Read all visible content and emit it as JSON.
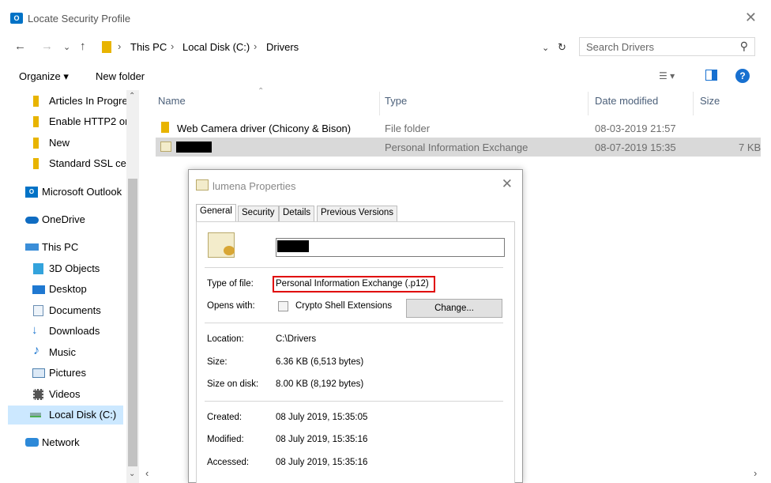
{
  "window": {
    "title": "Locate Security Profile",
    "title_icon": "O"
  },
  "address": {
    "crumbs": [
      "This PC",
      "Local Disk (C:)",
      "Drivers"
    ],
    "search_placeholder": "Search Drivers"
  },
  "toolbar": {
    "organize": "Organize ▾",
    "new_folder": "New folder"
  },
  "sidebar": {
    "items": [
      {
        "label": "Articles In Progre",
        "icon": "folder-icon"
      },
      {
        "label": "Enable HTTP2 or",
        "icon": "folder-icon"
      },
      {
        "label": "New",
        "icon": "folder-icon"
      },
      {
        "label": "Standard SSL cer",
        "icon": "folder-icon"
      },
      {
        "label": "Microsoft Outlook",
        "icon": "outlook-icon"
      },
      {
        "label": "OneDrive",
        "icon": "cloud-icon"
      },
      {
        "label": "This PC",
        "icon": "computer-icon"
      },
      {
        "label": "3D Objects",
        "icon": "cube-icon"
      },
      {
        "label": "Desktop",
        "icon": "desktop-icon"
      },
      {
        "label": "Documents",
        "icon": "document-icon"
      },
      {
        "label": "Downloads",
        "icon": "download-icon"
      },
      {
        "label": "Music",
        "icon": "music-icon"
      },
      {
        "label": "Pictures",
        "icon": "picture-icon"
      },
      {
        "label": "Videos",
        "icon": "video-icon"
      },
      {
        "label": "Local Disk (C:)",
        "icon": "drive-icon"
      },
      {
        "label": "Network",
        "icon": "network-icon"
      }
    ]
  },
  "file_list": {
    "columns": [
      "Name",
      "Type",
      "Date modified",
      "Size"
    ],
    "rows": [
      {
        "name": "Web Camera driver (Chicony & Bison)",
        "type": "File folder",
        "date": "08-03-2019 21:57",
        "size": ""
      },
      {
        "name": "",
        "type": "Personal Information Exchange",
        "date": "08-07-2019 15:35",
        "size": "7 KB"
      }
    ]
  },
  "dialog": {
    "title": "lumena Properties",
    "tabs": [
      "General",
      "Security",
      "Details",
      "Previous Versions"
    ],
    "fields": {
      "type_label": "Type of file:",
      "type_value": "Personal Information Exchange (.p12)",
      "opens_label": "Opens with:",
      "opens_value": "Crypto Shell Extensions",
      "change_button": "Change...",
      "location_label": "Location:",
      "location_value": "C:\\Drivers",
      "size_label": "Size:",
      "size_value": "6.36 KB (6,513 bytes)",
      "size_disk_label": "Size on disk:",
      "size_disk_value": "8.00 KB (8,192 bytes)",
      "created_label": "Created:",
      "created_value": "08 July 2019, 15:35:05",
      "modified_label": "Modified:",
      "modified_value": "08 July 2019, 15:35:16",
      "accessed_label": "Accessed:",
      "accessed_value": "08 July 2019, 15:35:16"
    },
    "highlight_color": "#e00000"
  }
}
